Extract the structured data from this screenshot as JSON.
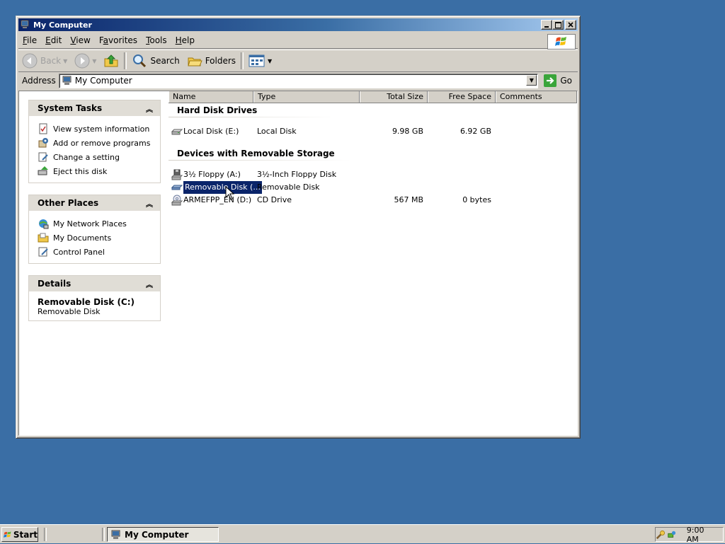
{
  "window": {
    "title": "My Computer",
    "menu": [
      "File",
      "Edit",
      "View",
      "Favorites",
      "Tools",
      "Help"
    ],
    "menu_access_keys": [
      "F",
      "E",
      "V",
      "a",
      "T",
      "H"
    ],
    "toolbar": {
      "back": "Back",
      "search": "Search",
      "folders": "Folders"
    },
    "address": {
      "label": "Address",
      "value": "My Computer",
      "go": "Go"
    }
  },
  "tasks": {
    "system_tasks": {
      "title": "System Tasks",
      "items": [
        "View system information",
        "Add or remove programs",
        "Change a setting",
        "Eject this disk"
      ]
    },
    "other_places": {
      "title": "Other Places",
      "items": [
        "My Network Places",
        "My Documents",
        "Control Panel"
      ]
    },
    "details": {
      "title": "Details",
      "name": "Removable Disk (C:)",
      "type": "Removable Disk"
    }
  },
  "list": {
    "columns": [
      "Name",
      "Type",
      "Total Size",
      "Free Space",
      "Comments"
    ],
    "groups": [
      {
        "title": "Hard Disk Drives",
        "rows": [
          {
            "name": "Local Disk (E:)",
            "type": "Local Disk",
            "total": "9.98 GB",
            "free": "6.92 GB",
            "icon": "hard-disk-icon"
          }
        ]
      },
      {
        "title": "Devices with Removable Storage",
        "rows": [
          {
            "name": "3½ Floppy (A:)",
            "type": "3½-Inch Floppy Disk",
            "total": "",
            "free": "",
            "icon": "floppy-drive-icon"
          },
          {
            "name": "Removable Disk (...",
            "type": "Removable Disk",
            "total": "",
            "free": "",
            "icon": "removable-disk-icon",
            "selected": true
          },
          {
            "name": "ARMEFPP_EN (D:)",
            "type": "CD Drive",
            "total": "567 MB",
            "free": "0 bytes",
            "icon": "cd-drive-icon"
          }
        ]
      }
    ]
  },
  "taskbar": {
    "start": "Start",
    "task": "My Computer",
    "clock": "9:00 AM"
  },
  "colors": {
    "desktop": "#3a6ea5",
    "title_active": "#0a246a",
    "selection": "#0a246a"
  }
}
